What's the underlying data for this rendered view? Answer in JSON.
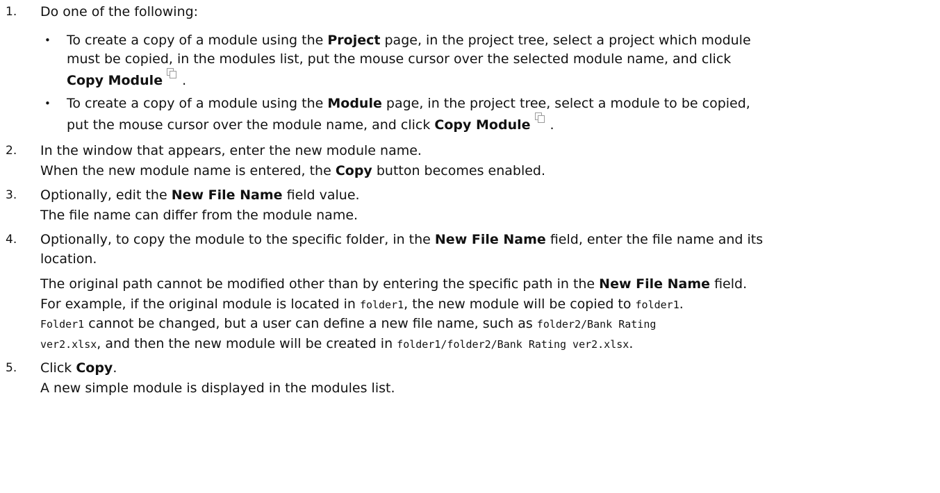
{
  "steps": [
    {
      "number": "1.",
      "text": "Do one of the following:",
      "bullets": [
        {
          "marker": "•",
          "line1": {
            "a": "To create a copy of a module using the ",
            "b": "Project",
            "c": " page, in the project tree, select a project which module"
          },
          "line2": "must be copied, in the modules list, put the mouse cursor over the selected module name, and click",
          "line3": {
            "bold": "Copy Module",
            "icon": "copy-icon",
            "end": " ."
          }
        },
        {
          "marker": "•",
          "line1": {
            "a": "To create a copy of a module using the ",
            "b": "Module",
            "c": " page, in the project tree, select a module to be copied,"
          },
          "line2": {
            "a": "put the mouse cursor over the module name, and click ",
            "bold": "Copy Module",
            "icon": "copy-icon",
            "end": " ."
          }
        }
      ]
    },
    {
      "number": "2.",
      "text": "In the window that appears, enter the new module name.",
      "note": {
        "a": "When the new module name is entered, the ",
        "b": "Copy",
        "c": " button becomes enabled."
      }
    },
    {
      "number": "3.",
      "text": {
        "a": "Optionally, edit the ",
        "b": "New File Name",
        "c": " field value."
      },
      "note": "The file name can differ from the module name."
    },
    {
      "number": "4.",
      "text": {
        "a": "Optionally, to copy the module to the specific folder, in the ",
        "b": "New File Name",
        "c": " field, enter the file name and its"
      },
      "text2": "location.",
      "note1": {
        "a": "The original path cannot be modified other than by entering the specific path in the ",
        "b": "New File Name",
        "c": " field."
      },
      "note2": {
        "a": "For example, if the original module is located in ",
        "code1": "folder1",
        "b": ", the new module will be copied to ",
        "code2": "folder1",
        "c": "."
      },
      "note3": {
        "code1": "Folder1",
        "a": " cannot be changed, but a user can define a new file name, such as ",
        "code2": "folder2/Bank Rating"
      },
      "note4": {
        "code1": "ver2.xlsx",
        "a": ", and then the new module will be created in ",
        "code2": "folder1/folder2/Bank Rating ver2.xlsx",
        "b": "."
      }
    },
    {
      "number": "5.",
      "text": {
        "a": "Click ",
        "b": "Copy",
        "c": "."
      },
      "note": "A new simple module is displayed in the modules list."
    }
  ]
}
